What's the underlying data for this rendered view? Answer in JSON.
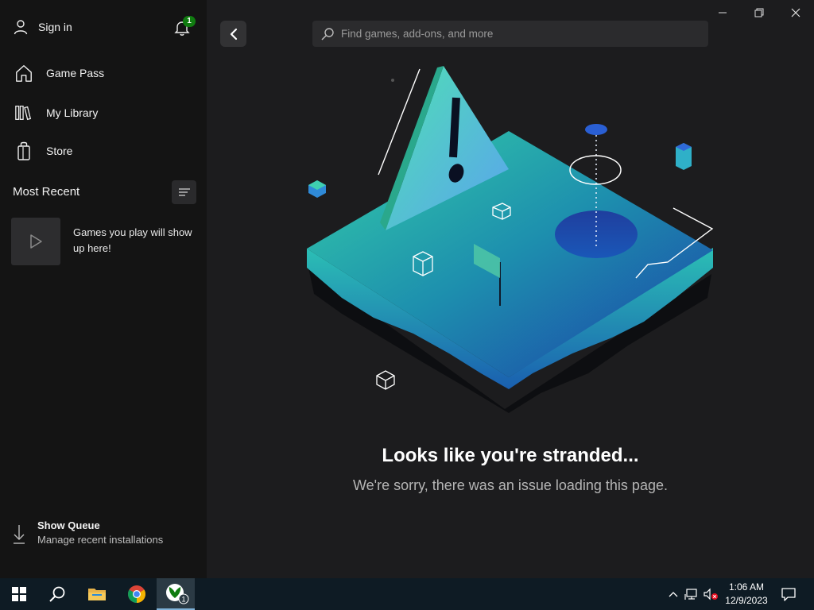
{
  "sidebar": {
    "sign_in": "Sign in",
    "notifications_count": "1",
    "nav": [
      {
        "label": "Game Pass",
        "icon": "home-icon"
      },
      {
        "label": "My Library",
        "icon": "library-icon"
      },
      {
        "label": "Store",
        "icon": "store-bag-icon"
      }
    ],
    "recent_title": "Most Recent",
    "recent_empty": "Games you play will show up here!",
    "queue_title": "Show Queue",
    "queue_subtitle": "Manage recent installations"
  },
  "search": {
    "placeholder": "Find games, add-ons, and more"
  },
  "error": {
    "title": "Looks like you're stranded...",
    "message": "We're sorry, there was an issue loading this page."
  },
  "taskbar": {
    "time": "1:06 AM",
    "date": "12/9/2023",
    "xbox_badge": "1",
    "apps": [
      "start-icon",
      "search-icon",
      "file-explorer-icon",
      "chrome-icon",
      "xbox-icon"
    ]
  },
  "colors": {
    "sidebar_bg": "#141414",
    "main_bg": "#1c1c1e",
    "badge_green": "#107c10",
    "teal": "#2fc7a8",
    "blue": "#2b5cc4"
  }
}
